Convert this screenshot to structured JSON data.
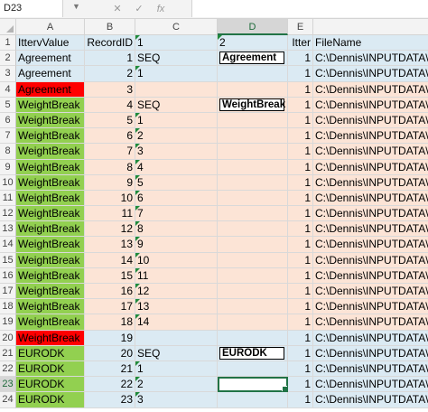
{
  "name_box": "D23",
  "formula_bar": {
    "cancel_icon": "✕",
    "enter_icon": "✓",
    "fx_label": "fx",
    "value": ""
  },
  "columns": [
    "A",
    "B",
    "C",
    "D",
    "E"
  ],
  "active_cell": {
    "col": "D",
    "row": "23"
  },
  "colors": {
    "light_blue": "#dbeaf3",
    "peach": "#fce4d6",
    "green": "#92d050",
    "red": "#ff0000",
    "selection": "#217346"
  },
  "rows": [
    {
      "n": "1",
      "band": "blue",
      "a": "IttervValue",
      "a_fill": "",
      "b": "RecordID",
      "c": "1",
      "c_tri": true,
      "d": "2",
      "d_tri": true,
      "d_box": false,
      "e": "Itter",
      "f": "FileName"
    },
    {
      "n": "2",
      "band": "blue",
      "a": "Agreement",
      "a_fill": "",
      "b": "1",
      "c": "SEQ",
      "c_tri": false,
      "d": "Agreement",
      "d_tri": false,
      "d_box": true,
      "e": "1",
      "f": "C:\\Dennis\\INPUTDATA\\"
    },
    {
      "n": "3",
      "band": "blue",
      "a": "Agreement",
      "a_fill": "",
      "b": "2",
      "c": "1",
      "c_tri": true,
      "d": "",
      "d_tri": false,
      "d_box": false,
      "e": "1",
      "f": "C:\\Dennis\\INPUTDATA\\"
    },
    {
      "n": "4",
      "band": "peach",
      "a": "Agreement",
      "a_fill": "red",
      "b": "3",
      "c": "",
      "c_tri": false,
      "d": "",
      "d_tri": false,
      "d_box": false,
      "e": "1",
      "f": "C:\\Dennis\\INPUTDATA\\"
    },
    {
      "n": "5",
      "band": "peach",
      "a": "WeightBreak",
      "a_fill": "green",
      "b": "4",
      "c": "SEQ",
      "c_tri": false,
      "d": "WeightBreak",
      "d_tri": false,
      "d_box": true,
      "e": "1",
      "f": "C:\\Dennis\\INPUTDATA\\"
    },
    {
      "n": "6",
      "band": "peach",
      "a": "WeightBreak",
      "a_fill": "green",
      "b": "5",
      "c": "1",
      "c_tri": true,
      "d": "",
      "d_tri": false,
      "d_box": false,
      "e": "1",
      "f": "C:\\Dennis\\INPUTDATA\\"
    },
    {
      "n": "7",
      "band": "peach",
      "a": "WeightBreak",
      "a_fill": "green",
      "b": "6",
      "c": "2",
      "c_tri": true,
      "d": "",
      "d_tri": false,
      "d_box": false,
      "e": "1",
      "f": "C:\\Dennis\\INPUTDATA\\"
    },
    {
      "n": "8",
      "band": "peach",
      "a": "WeightBreak",
      "a_fill": "green",
      "b": "7",
      "c": "3",
      "c_tri": true,
      "d": "",
      "d_tri": false,
      "d_box": false,
      "e": "1",
      "f": "C:\\Dennis\\INPUTDATA\\"
    },
    {
      "n": "9",
      "band": "peach",
      "a": "WeightBreak",
      "a_fill": "green",
      "b": "8",
      "c": "4",
      "c_tri": true,
      "d": "",
      "d_tri": false,
      "d_box": false,
      "e": "1",
      "f": "C:\\Dennis\\INPUTDATA\\"
    },
    {
      "n": "10",
      "band": "peach",
      "a": "WeightBreak",
      "a_fill": "green",
      "b": "9",
      "c": "5",
      "c_tri": true,
      "d": "",
      "d_tri": false,
      "d_box": false,
      "e": "1",
      "f": "C:\\Dennis\\INPUTDATA\\"
    },
    {
      "n": "11",
      "band": "peach",
      "a": "WeightBreak",
      "a_fill": "green",
      "b": "10",
      "c": "6",
      "c_tri": true,
      "d": "",
      "d_tri": false,
      "d_box": false,
      "e": "1",
      "f": "C:\\Dennis\\INPUTDATA\\"
    },
    {
      "n": "12",
      "band": "peach",
      "a": "WeightBreak",
      "a_fill": "green",
      "b": "11",
      "c": "7",
      "c_tri": true,
      "d": "",
      "d_tri": false,
      "d_box": false,
      "e": "1",
      "f": "C:\\Dennis\\INPUTDATA\\"
    },
    {
      "n": "13",
      "band": "peach",
      "a": "WeightBreak",
      "a_fill": "green",
      "b": "12",
      "c": "8",
      "c_tri": true,
      "d": "",
      "d_tri": false,
      "d_box": false,
      "e": "1",
      "f": "C:\\Dennis\\INPUTDATA\\"
    },
    {
      "n": "14",
      "band": "peach",
      "a": "WeightBreak",
      "a_fill": "green",
      "b": "13",
      "c": "9",
      "c_tri": true,
      "d": "",
      "d_tri": false,
      "d_box": false,
      "e": "1",
      "f": "C:\\Dennis\\INPUTDATA\\"
    },
    {
      "n": "15",
      "band": "peach",
      "a": "WeightBreak",
      "a_fill": "green",
      "b": "14",
      "c": "10",
      "c_tri": true,
      "d": "",
      "d_tri": false,
      "d_box": false,
      "e": "1",
      "f": "C:\\Dennis\\INPUTDATA\\"
    },
    {
      "n": "16",
      "band": "peach",
      "a": "WeightBreak",
      "a_fill": "green",
      "b": "15",
      "c": "11",
      "c_tri": true,
      "d": "",
      "d_tri": false,
      "d_box": false,
      "e": "1",
      "f": "C:\\Dennis\\INPUTDATA\\"
    },
    {
      "n": "17",
      "band": "peach",
      "a": "WeightBreak",
      "a_fill": "green",
      "b": "16",
      "c": "12",
      "c_tri": true,
      "d": "",
      "d_tri": false,
      "d_box": false,
      "e": "1",
      "f": "C:\\Dennis\\INPUTDATA\\"
    },
    {
      "n": "18",
      "band": "peach",
      "a": "WeightBreak",
      "a_fill": "green",
      "b": "17",
      "c": "13",
      "c_tri": true,
      "d": "",
      "d_tri": false,
      "d_box": false,
      "e": "1",
      "f": "C:\\Dennis\\INPUTDATA\\"
    },
    {
      "n": "19",
      "band": "peach",
      "a": "WeightBreak",
      "a_fill": "green",
      "b": "18",
      "c": "14",
      "c_tri": true,
      "d": "",
      "d_tri": false,
      "d_box": false,
      "e": "1",
      "f": "C:\\Dennis\\INPUTDATA\\"
    },
    {
      "n": "20",
      "band": "blue",
      "a": "WeightBreak",
      "a_fill": "red",
      "b": "19",
      "c": "",
      "c_tri": false,
      "d": "",
      "d_tri": false,
      "d_box": false,
      "e": "1",
      "f": "C:\\Dennis\\INPUTDATA\\"
    },
    {
      "n": "21",
      "band": "blue",
      "a": "EURODK",
      "a_fill": "green",
      "b": "20",
      "c": "SEQ",
      "c_tri": false,
      "d": "EURODK",
      "d_tri": false,
      "d_box": true,
      "e": "1",
      "f": "C:\\Dennis\\INPUTDATA\\"
    },
    {
      "n": "22",
      "band": "blue",
      "a": "EURODK",
      "a_fill": "green",
      "b": "21",
      "c": "1",
      "c_tri": true,
      "d": "",
      "d_tri": false,
      "d_box": false,
      "e": "1",
      "f": "C:\\Dennis\\INPUTDATA\\"
    },
    {
      "n": "23",
      "band": "blue",
      "a": "EURODK",
      "a_fill": "green",
      "b": "22",
      "c": "2",
      "c_tri": true,
      "d": "",
      "d_tri": false,
      "d_box": false,
      "e": "1",
      "f": "C:\\Dennis\\INPUTDATA\\"
    },
    {
      "n": "24",
      "band": "blue",
      "a": "EURODK",
      "a_fill": "green",
      "b": "23",
      "c": "3",
      "c_tri": true,
      "d": "",
      "d_tri": false,
      "d_box": false,
      "e": "1",
      "f": "C:\\Dennis\\INPUTDATA\\"
    }
  ]
}
